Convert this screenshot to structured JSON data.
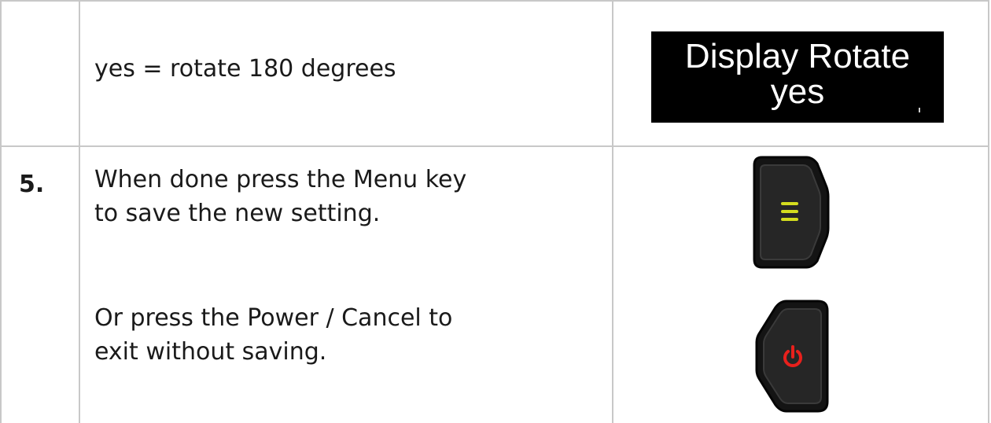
{
  "rows": [
    {
      "step": "",
      "text": "yes = rotate 180 degrees",
      "display": {
        "line1": "Display Rotate",
        "line2": "yes"
      }
    },
    {
      "step": "5.",
      "text_a_line1": "When done press the Menu key",
      "text_a_line2": "to save the new setting.",
      "text_b_line1": "Or press the Power / Cancel to",
      "text_b_line2": "exit without saving.",
      "menu_key_icon": "menu-icon",
      "power_key_icon": "power-icon"
    }
  ],
  "colors": {
    "border": "#c8c8c8",
    "menu_lines": "#d4dc1e",
    "power_symbol": "#e8201c",
    "key_body": "#1c1c1c"
  }
}
